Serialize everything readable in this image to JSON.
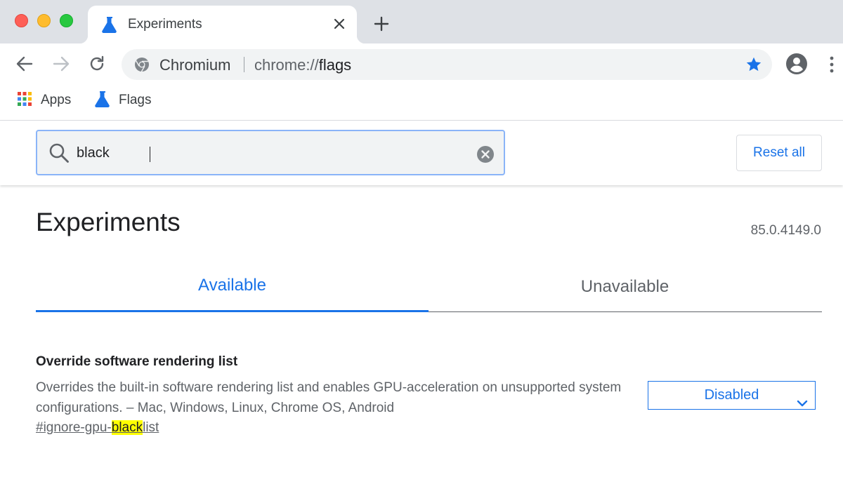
{
  "colors": {
    "accent": "#1a73e8",
    "highlight": "#ffff00",
    "tabstrip": "#dee1e6",
    "omnibox": "#f1f3f4"
  },
  "browser": {
    "tab": {
      "title": "Experiments",
      "icon": "flask-icon"
    },
    "omnibox": {
      "site_name": "Chromium",
      "url_scheme": "chrome://",
      "url_host": "flags"
    },
    "bookmarks": [
      {
        "label": "Apps",
        "icon": "apps-grid-icon"
      },
      {
        "label": "Flags",
        "icon": "flask-icon"
      }
    ]
  },
  "flags_page": {
    "search": {
      "value": "black"
    },
    "reset_label": "Reset all",
    "title": "Experiments",
    "version": "85.0.4149.0",
    "tabs": [
      {
        "label": "Available",
        "active": true
      },
      {
        "label": "Unavailable",
        "active": false
      }
    ],
    "experiment": {
      "name": "Override software rendering list",
      "description": "Overrides the built-in software rendering list and enables GPU-acceleration on unsupported system configurations. – Mac, Windows, Linux, Chrome OS, Android",
      "link_prefix": "#ignore-gpu-",
      "link_match": "black",
      "link_suffix": "list",
      "selected_option": "Disabled"
    }
  }
}
